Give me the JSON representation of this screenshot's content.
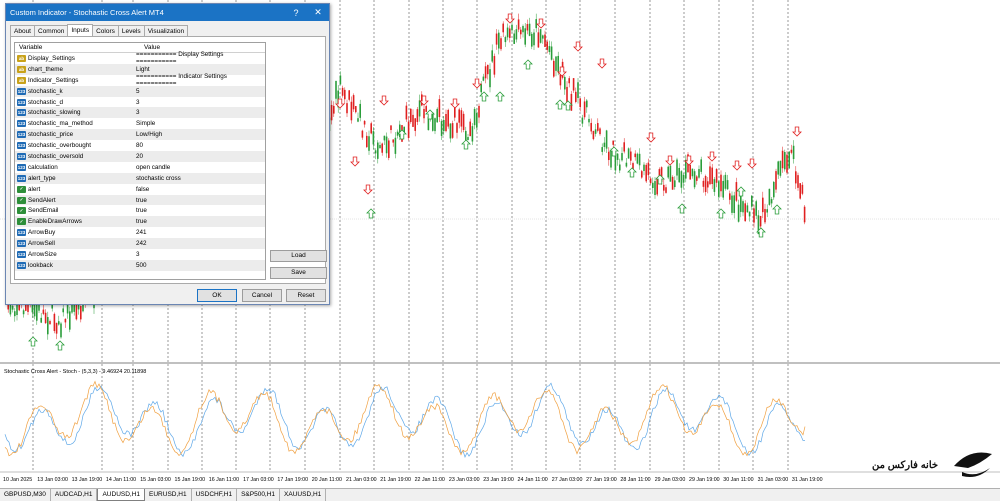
{
  "dialog": {
    "title": "Custom Indicator - Stochastic Cross Alert MT4",
    "help_glyph": "?",
    "close_glyph": "✕",
    "tabs": [
      "About",
      "Common",
      "Inputs",
      "Colors",
      "Levels",
      "Visualization"
    ],
    "active_tab": "Inputs",
    "columns": {
      "variable": "Variable",
      "value": "Value"
    },
    "inputs": [
      {
        "name": "Display_Settings",
        "value": "=========== Display Settings ===========",
        "kind": "ab"
      },
      {
        "name": "chart_theme",
        "value": "Light",
        "kind": "ab"
      },
      {
        "name": "Indicator_Settings",
        "value": "=========== Indicator Settings ===========",
        "kind": "ab"
      },
      {
        "name": "stochastic_k",
        "value": "5",
        "kind": "num"
      },
      {
        "name": "stochastic_d",
        "value": "3",
        "kind": "num"
      },
      {
        "name": "stochastic_slowing",
        "value": "3",
        "kind": "num"
      },
      {
        "name": "stochastic_ma_method",
        "value": "Simple",
        "kind": "num"
      },
      {
        "name": "stochastic_price",
        "value": "Low/High",
        "kind": "num"
      },
      {
        "name": "stochastic_overbought",
        "value": "80",
        "kind": "num"
      },
      {
        "name": "stochastic_oversold",
        "value": "20",
        "kind": "num"
      },
      {
        "name": "calculation",
        "value": "open candle",
        "kind": "num"
      },
      {
        "name": "alert_type",
        "value": "stochastic cross",
        "kind": "num"
      },
      {
        "name": "alert",
        "value": "false",
        "kind": "bool"
      },
      {
        "name": "SendAlert",
        "value": "true",
        "kind": "bool"
      },
      {
        "name": "SendEmail",
        "value": "true",
        "kind": "bool"
      },
      {
        "name": "EnableDrawArrows",
        "value": "true",
        "kind": "bool"
      },
      {
        "name": "ArrowBuy",
        "value": "241",
        "kind": "num"
      },
      {
        "name": "ArrowSell",
        "value": "242",
        "kind": "num"
      },
      {
        "name": "ArrowSize",
        "value": "3",
        "kind": "num"
      },
      {
        "name": "lookback",
        "value": "500",
        "kind": "num"
      }
    ],
    "load_label": "Load",
    "save_label": "Save",
    "ok_label": "OK",
    "cancel_label": "Cancel",
    "reset_label": "Reset"
  },
  "indicator_label": "Stochastic Cross Alert - Stoch - (5,3,3) - 9.46924 20.11898",
  "time_axis": [
    "10 Jan 2025",
    "13 Jan 03:00",
    "13 Jan 19:00",
    "14 Jan 11:00",
    "15 Jan 03:00",
    "15 Jan 19:00",
    "16 Jan 11:00",
    "17 Jan 03:00",
    "17 Jan 19:00",
    "20 Jan 11:00",
    "21 Jan 03:00",
    "21 Jan 19:00",
    "22 Jan 11:00",
    "23 Jan 03:00",
    "23 Jan 19:00",
    "24 Jan 11:00",
    "27 Jan 03:00",
    "27 Jan 19:00",
    "28 Jan 11:00",
    "29 Jan 03:00",
    "29 Jan 19:00",
    "30 Jan 11:00",
    "31 Jan 03:00",
    "31 Jan 19:00"
  ],
  "symbol_tabs": [
    "GBPUSD,M30",
    "AUDCAD,H1",
    "AUDUSD,H1",
    "EURUSD,H1",
    "USDCHF,H1",
    "S&P500,H1",
    "XAUUSD,H1"
  ],
  "active_symbol": "AUDUSD,H1",
  "brand_text": "خانه فارکس من",
  "colors": {
    "bull": "#2a9d3a",
    "bear": "#e02020",
    "main_line": "#f0a040",
    "signal_line": "#5fa8e8",
    "title_bar": "#1b73c5"
  }
}
